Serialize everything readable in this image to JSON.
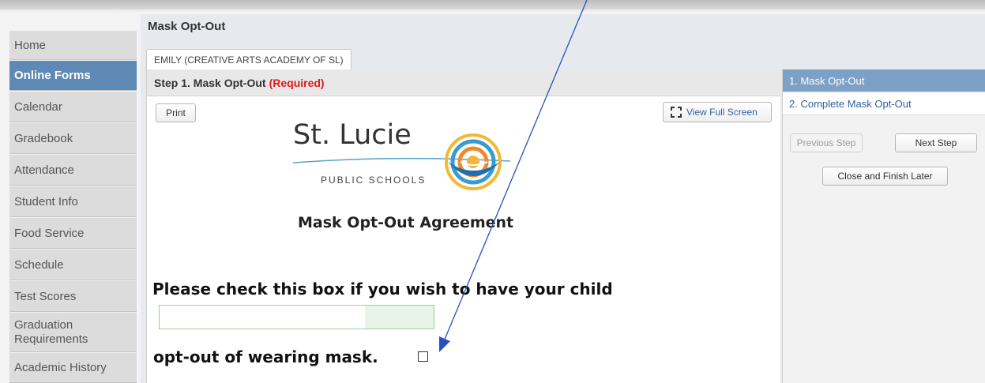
{
  "sidebar": {
    "items": [
      {
        "label": "Home"
      },
      {
        "label": "Online Forms"
      },
      {
        "label": "Calendar"
      },
      {
        "label": "Gradebook"
      },
      {
        "label": "Attendance"
      },
      {
        "label": "Student Info"
      },
      {
        "label": "Food Service"
      },
      {
        "label": "Schedule"
      },
      {
        "label": "Test Scores"
      },
      {
        "label_line1": "Graduation",
        "label_line2": "Requirements"
      },
      {
        "label": "Academic History"
      }
    ],
    "active_item": "Online Forms"
  },
  "page": {
    "title": "Mask Opt-Out",
    "student_tab": "EMILY (CREATIVE ARTS ACADEMY OF SL)"
  },
  "form": {
    "step_title": "Step 1. Mask Opt-Out",
    "required_label": "(Required)",
    "print_button": "Print",
    "fullscreen_button": "View Full Screen",
    "logo_text": "St. Lucie",
    "logo_subtext": "PUBLIC SCHOOLS",
    "agreement_title": "Mask Opt-Out Agreement",
    "instruction": "Please check this box if you wish to have your child",
    "input_value": "",
    "optout_label": "opt-out of wearing mask.",
    "checkbox_checked": false
  },
  "steps": {
    "items": [
      {
        "label": "1. Mask Opt-Out"
      },
      {
        "label": "2. Complete Mask Opt-Out"
      }
    ],
    "previous_button": "Previous Step",
    "next_button": "Next Step",
    "close_button": "Close and Finish Later"
  },
  "colors": {
    "nav_active": "#5d89b4",
    "required": "#e0191b",
    "step_active": "#7da0c6",
    "annotation_arrow": "#2a4fc0"
  }
}
